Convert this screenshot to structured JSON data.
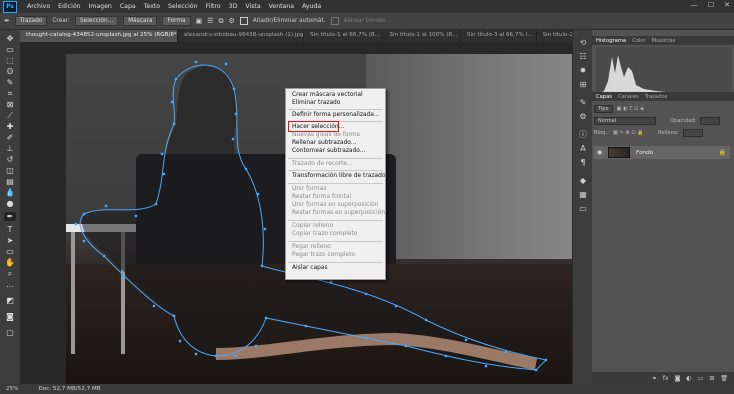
{
  "menubar": {
    "logo": "Ps",
    "items": [
      "Archivo",
      "Edición",
      "Imagen",
      "Capa",
      "Texto",
      "Selección",
      "Filtro",
      "3D",
      "Vista",
      "Ventana",
      "Ayuda"
    ],
    "window_controls": [
      "—",
      "☐",
      "✕"
    ]
  },
  "options_bar": {
    "tool_mode": "Trazado",
    "make_label": "Crear:",
    "selection_button": "Selección...",
    "mask_button": "Máscara",
    "shape_button": "Forma",
    "auto_add_label": "Añadir/Eliminar automát.",
    "align_edges_label": "Alinear bordes"
  },
  "doc_tabs": [
    {
      "label": "thought-catalog-434852-unsplash.jpg al 25% (RGB/8*)",
      "active": true
    },
    {
      "label": "alexandru-zdrobau-98438-unsplash (1).jpg",
      "active": false
    },
    {
      "label": "Sin título-1 al 66,7% (R...",
      "active": false
    },
    {
      "label": "Sin título-1 al 100% (R...",
      "active": false
    },
    {
      "label": "Sin título-3 al 66,7% (...",
      "active": false
    },
    {
      "label": "Sin título-2 al...",
      "active": false
    }
  ],
  "context_menu": {
    "items": [
      {
        "label": "Crear máscara vectorial",
        "enabled": true
      },
      {
        "label": "Eliminar trazado",
        "enabled": true
      },
      {
        "label": "Definir forma personalizada...",
        "enabled": true
      },
      {
        "label": "Hacer selección...",
        "enabled": true,
        "highlighted": true
      },
      {
        "label": "Nuevas guías de forma",
        "enabled": false
      },
      {
        "label": "Rellenar subtrazado...",
        "enabled": true
      },
      {
        "label": "Contornear subtrazado...",
        "enabled": true
      },
      {
        "label": "Trazado de recorte...",
        "enabled": false
      },
      {
        "label": "Transformación libre de trazado",
        "enabled": true
      },
      {
        "label": "Unir formas",
        "enabled": false
      },
      {
        "label": "Restar forma frontal",
        "enabled": false
      },
      {
        "label": "Unir formas en superposición",
        "enabled": false
      },
      {
        "label": "Restar formas en superposición",
        "enabled": false
      },
      {
        "label": "Copiar relleno",
        "enabled": false
      },
      {
        "label": "Copiar trazo completo",
        "enabled": false
      },
      {
        "label": "Pegar relleno",
        "enabled": false
      },
      {
        "label": "Pegar trazo completo",
        "enabled": false
      },
      {
        "label": "Aislar capas",
        "enabled": true
      }
    ]
  },
  "status_bar": {
    "zoom": "25%",
    "doc_info": "Doc: 52,7 MB/52,7 MB"
  },
  "panels": {
    "top_tabs": [
      "Histograma",
      "Color",
      "Muestras"
    ],
    "layer_tabs": [
      "Capas",
      "Canales",
      "Trazados"
    ],
    "blend_mode": "Normal",
    "opacity_label": "Opacidad:",
    "fill_label": "Relleno:",
    "lock_label": "Bloq.:",
    "kind_label": "Tipo",
    "layer_name": "Fondo"
  },
  "colors": {
    "path_color": "#4aa8ff",
    "highlight_color": "#e3121b"
  }
}
